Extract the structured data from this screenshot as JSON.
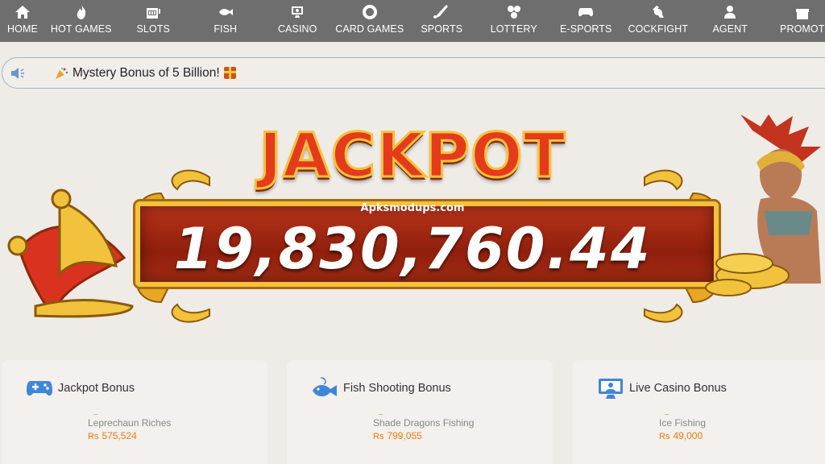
{
  "nav": {
    "items": [
      {
        "label": "HOME",
        "icon": "home-icon"
      },
      {
        "label": "HOT GAMES",
        "icon": "fire-icon"
      },
      {
        "label": "SLOTS",
        "icon": "slot-machine-icon"
      },
      {
        "label": "FISH",
        "icon": "fish-icon"
      },
      {
        "label": "CASINO",
        "icon": "dealer-icon"
      },
      {
        "label": "CARD GAMES",
        "icon": "poker-chip-icon"
      },
      {
        "label": "SPORTS",
        "icon": "hockey-icon"
      },
      {
        "label": "LOTTERY",
        "icon": "lottery-balls-icon"
      },
      {
        "label": "E-SPORTS",
        "icon": "gamepad-icon"
      },
      {
        "label": "COCKFIGHT",
        "icon": "rooster-icon"
      },
      {
        "label": "AGENT",
        "icon": "agent-icon"
      },
      {
        "label": "PROMOT",
        "icon": "gift-icon"
      }
    ]
  },
  "marquee": {
    "text": "Mystery Bonus of 5 Billion!",
    "icon": "speaker-icon"
  },
  "jackpot": {
    "title": "JACKPOT",
    "watermark": "Apksmodups.com",
    "amount": "19,830,760.44"
  },
  "cards": [
    {
      "title": "Jackpot Bonus",
      "icon": "gamepad-icon",
      "game": "Leprechaun Riches",
      "currency": "Rs",
      "amount": "575,524"
    },
    {
      "title": "Fish Shooting Bonus",
      "icon": "fish-icon",
      "game": "Shade Dragons Fishing",
      "currency": "Rs",
      "amount": "799,055"
    },
    {
      "title": "Live Casino Bonus",
      "icon": "dealer-icon",
      "game": "Ice Fishing",
      "currency": "Rs",
      "amount": "49,000"
    }
  ],
  "colors": {
    "nav_bg": "#6e6e6e",
    "page_bg": "#efebe7",
    "accent_orange": "#f07a10",
    "card_icon_blue": "#3f86d8",
    "jackpot_red": "#e33b1c",
    "gold": "#f2c23c"
  }
}
